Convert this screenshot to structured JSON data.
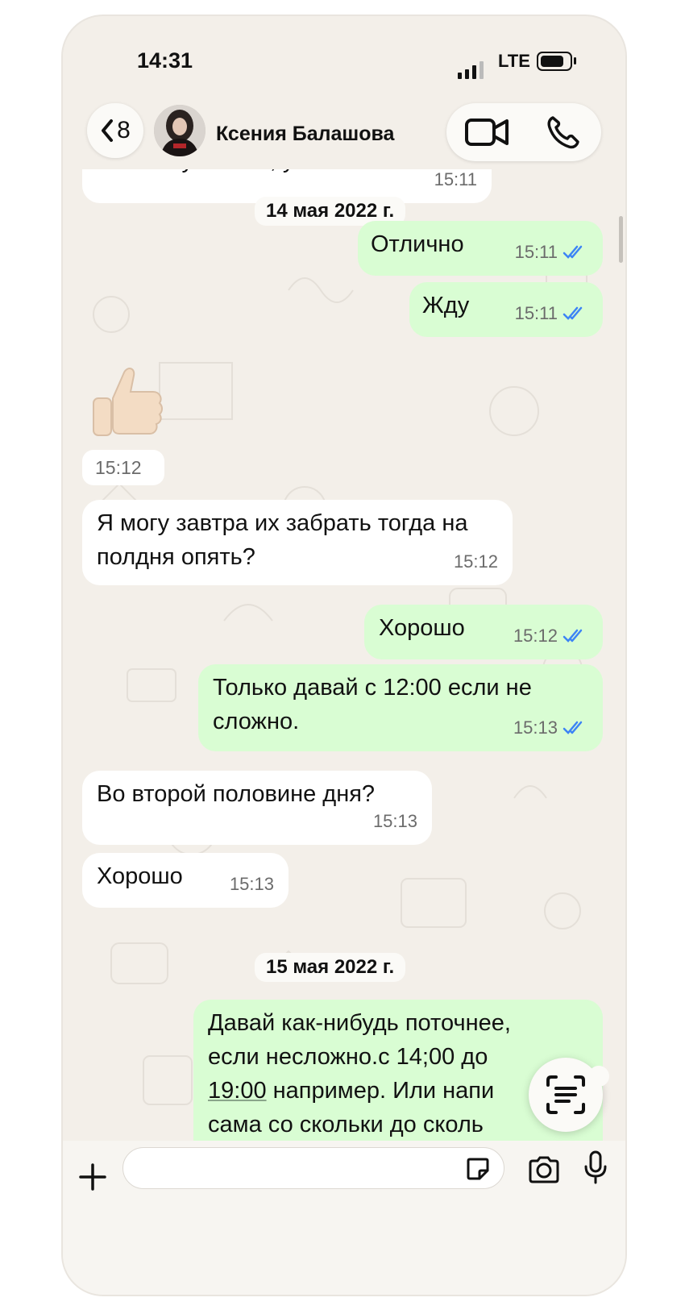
{
  "status": {
    "time": "14:31",
    "network": "LTE"
  },
  "header": {
    "back_count": "8",
    "contact_name": "Ксения Балашова"
  },
  "messages": [
    {
      "dir": "in",
      "text": "Они нагулялись, устали",
      "time": "15:11"
    },
    {
      "type": "date",
      "text": "14 мая 2022 г."
    },
    {
      "dir": "out",
      "text": "Отлично",
      "time": "15:11",
      "read": true
    },
    {
      "dir": "out",
      "text": "Жду",
      "time": "15:11",
      "read": true
    },
    {
      "dir": "in",
      "emoji": "👍",
      "time": "15:12"
    },
    {
      "dir": "in",
      "text": "Я могу завтра их забрать тогда на полдня опять?",
      "time": "15:12"
    },
    {
      "dir": "out",
      "text": "Хорошо",
      "time": "15:12",
      "read": true
    },
    {
      "dir": "out",
      "text": "Только давай с 12:00 если не сложно.",
      "time": "15:13",
      "read": true
    },
    {
      "dir": "in",
      "text": "Во второй половине дня?",
      "time": "15:13"
    },
    {
      "dir": "in",
      "text": "Хорошо",
      "time": "15:13"
    },
    {
      "type": "date",
      "text": "15 мая 2022 г."
    },
    {
      "dir": "out",
      "text_lines": [
        "Давай как-нибудь поточнее,",
        "если несложно.с 14;00 до",
        "19:00",
        " например. Или напи",
        "сама со скольки до сколь"
      ]
    }
  ],
  "colors": {
    "incoming": "#ffffff",
    "outgoing": "#d9fdd3",
    "read_ticks": "#3d84f5",
    "background": "#f3efe9"
  },
  "icons": [
    "back-chevron-icon",
    "video-call-icon",
    "phone-icon",
    "plus-icon",
    "sticker-icon",
    "camera-icon",
    "mic-icon",
    "live-text-icon",
    "double-check-icon"
  ]
}
